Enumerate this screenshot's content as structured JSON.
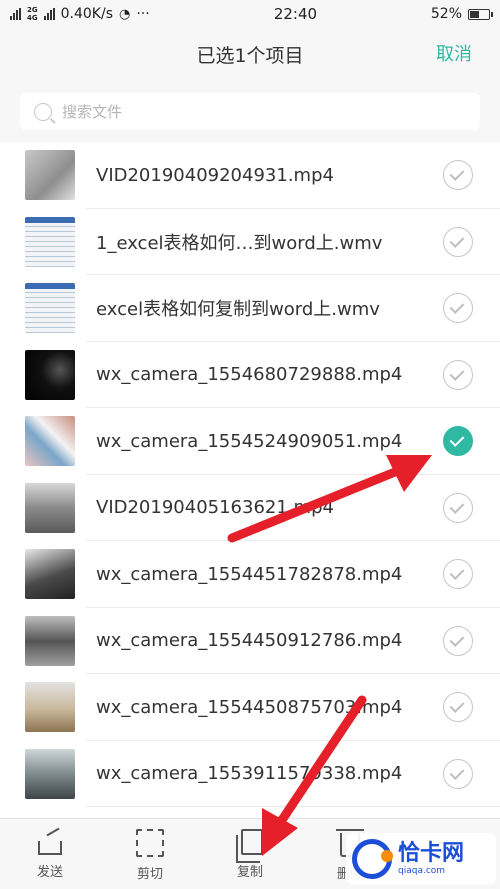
{
  "status_bar": {
    "network_small_1": "2G",
    "network_small_2": "4G",
    "speed": "0.40K/s",
    "dots": "···",
    "time": "22:40",
    "battery": "52%",
    "battery_level": 0.52
  },
  "header": {
    "title": "已选1个项目",
    "cancel_label": "取消",
    "accent_color": "#2fb9a3"
  },
  "search": {
    "placeholder": "搜索文件"
  },
  "files": [
    {
      "name": "VID20190409204931.mp4",
      "selected": false,
      "thumb": "grey"
    },
    {
      "name": "1_excel表格如何…到word上.wmv",
      "selected": false,
      "thumb": "sheet"
    },
    {
      "name": "excel表格如何复制到word上.wmv",
      "selected": false,
      "thumb": "sheet"
    },
    {
      "name": "wx_camera_1554680729888.mp4",
      "selected": false,
      "thumb": "dark"
    },
    {
      "name": "wx_camera_1554524909051.mp4",
      "selected": true,
      "thumb": "pink"
    },
    {
      "name": "VID20190405163621.mp4",
      "selected": false,
      "thumb": "room"
    },
    {
      "name": "wx_camera_1554451782878.mp4",
      "selected": false,
      "thumb": "table"
    },
    {
      "name": "wx_camera_1554450912786.mp4",
      "selected": false,
      "thumb": "sofa"
    },
    {
      "name": "wx_camera_1554450875703.mp4",
      "selected": false,
      "thumb": "floor"
    },
    {
      "name": "wx_camera_1553911579338.mp4",
      "selected": false,
      "thumb": "room2"
    }
  ],
  "toolbar": {
    "send": "发送",
    "cut": "剪切",
    "copy": "复制",
    "delete": "删除"
  },
  "watermark": {
    "title": "恰卡网",
    "url": "qiaqa.com"
  },
  "annotation_color": "#e5202a"
}
